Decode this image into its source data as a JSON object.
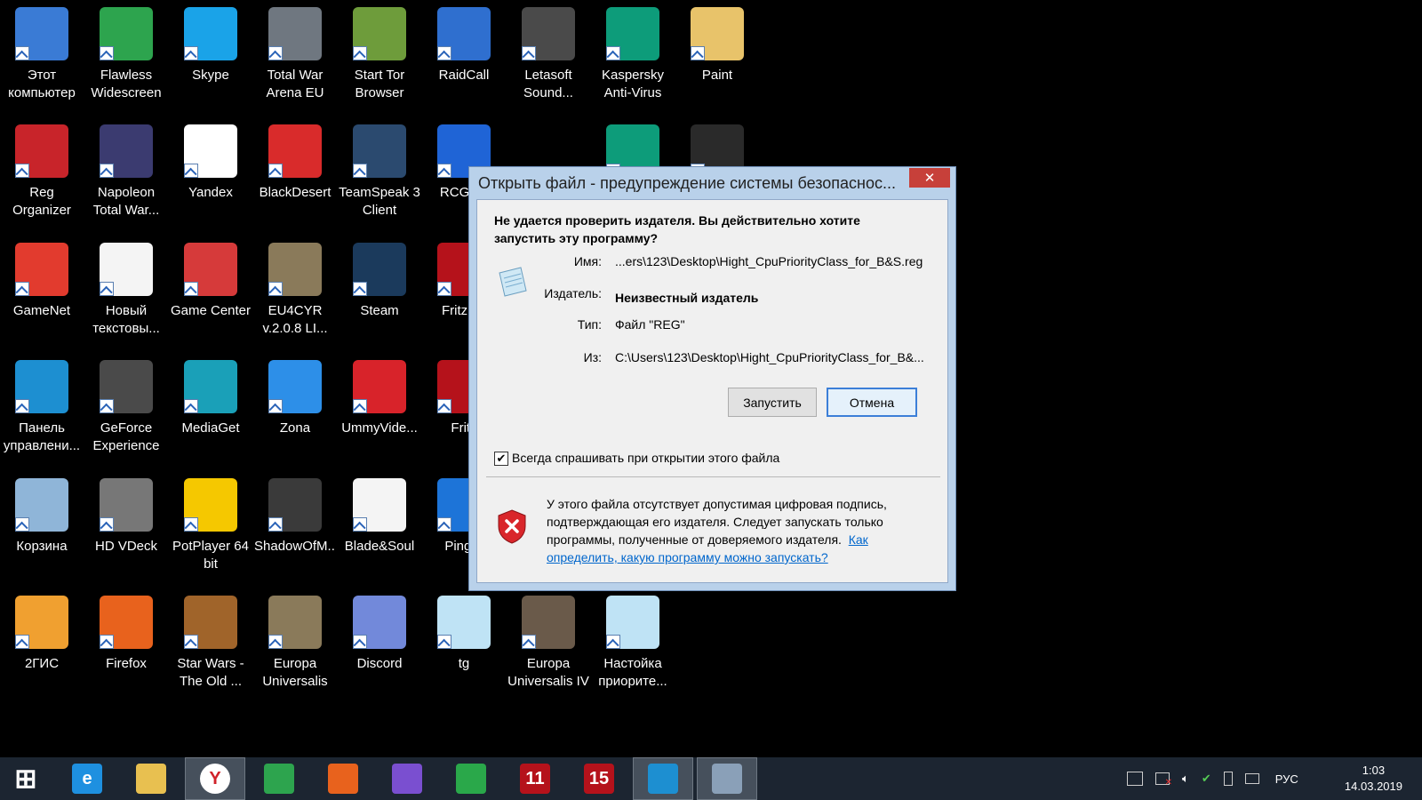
{
  "desktop": {
    "icons": [
      {
        "label": "Этот компьютер",
        "icon": "computer-icon",
        "color": "#3a7bd5"
      },
      {
        "label": "Flawless Widescreen",
        "icon": "flawless-widescreen-icon",
        "color": "#2da44e"
      },
      {
        "label": "Skype",
        "icon": "skype-icon",
        "color": "#1aa3e8"
      },
      {
        "label": "Total War Arena EU",
        "icon": "total-war-arena-icon",
        "color": "#6f7780"
      },
      {
        "label": "Start Tor Browser",
        "icon": "tor-browser-icon",
        "color": "#6e9c3b"
      },
      {
        "label": "RaidCall",
        "icon": "raidcall-icon",
        "color": "#2f6fcf"
      },
      {
        "label": "Letasoft Sound...",
        "icon": "letasoft-sound-icon",
        "color": "#4a4a4a"
      },
      {
        "label": "Kaspersky Anti-Virus",
        "icon": "kaspersky-icon",
        "color": "#0d9c7a"
      },
      {
        "label": "Paint",
        "icon": "paint-icon",
        "color": "#e8c36a"
      },
      {
        "label": "Reg Organizer",
        "icon": "reg-organizer-icon",
        "color": "#c8242a"
      },
      {
        "label": "Napoleon Total War...",
        "icon": "napoleon-icon",
        "color": "#3b3b70"
      },
      {
        "label": "Yandex",
        "icon": "yandex-icon",
        "color": "#ffffff"
      },
      {
        "label": "BlackDesert",
        "icon": "blackdesert-icon",
        "color": "#d92b2b"
      },
      {
        "label": "TeamSpeak 3 Client",
        "icon": "teamspeak-icon",
        "color": "#2b4a6f"
      },
      {
        "label": "RCGam",
        "icon": "rcgame-icon",
        "color": "#1f64d6"
      },
      {
        "label": "",
        "icon": "kaspersky-vpn-icon",
        "color": "#0d9c7a"
      },
      {
        "label": "",
        "icon": "app-icon",
        "color": "#2a2a2a"
      },
      {
        "label": "GameNet",
        "icon": "gamenet-icon",
        "color": "#e23b2e"
      },
      {
        "label": "Новый текстовы...",
        "icon": "text-file-icon",
        "color": "#f4f4f4"
      },
      {
        "label": "Game Center",
        "icon": "game-center-icon",
        "color": "#d63a3a"
      },
      {
        "label": "EU4CYR v.2.0.8 LI...",
        "icon": "eu4cyr-icon",
        "color": "#8a7a5a"
      },
      {
        "label": "Steam",
        "icon": "steam-icon",
        "color": "#1b3a5c"
      },
      {
        "label": "Fritz 15",
        "icon": "fritz15-icon",
        "color": "#b5121b"
      },
      {
        "label": "Панель управлени...",
        "icon": "control-panel-icon",
        "color": "#1d8fd1"
      },
      {
        "label": "GeForce Experience",
        "icon": "geforce-icon",
        "color": "#4a4a4a"
      },
      {
        "label": "MediaGet",
        "icon": "mediaget-icon",
        "color": "#1aa0b8"
      },
      {
        "label": "Zona",
        "icon": "zona-icon",
        "color": "#2d8fe8"
      },
      {
        "label": "UmmyVide...",
        "icon": "ummy-video-icon",
        "color": "#d8232a"
      },
      {
        "label": "Fritz",
        "icon": "fritz-icon",
        "color": "#b5121b"
      },
      {
        "label": "Корзина",
        "icon": "recycle-bin-icon",
        "color": "#8fb5d8"
      },
      {
        "label": "HD VDeck",
        "icon": "hd-vdeck-icon",
        "color": "#777777"
      },
      {
        "label": "PotPlayer 64 bit",
        "icon": "potplayer-icon",
        "color": "#f5c800"
      },
      {
        "label": "ShadowOfM...",
        "icon": "shadow-of-mordor-icon",
        "color": "#3a3a3a"
      },
      {
        "label": "Blade&Soul",
        "icon": "blade-soul-icon",
        "color": "#f4f4f4"
      },
      {
        "label": "PingPl",
        "icon": "pingplotter-icon",
        "color": "#1d74d8"
      },
      {
        "label": "2ГИС",
        "icon": "2gis-icon",
        "color": "#f0a030"
      },
      {
        "label": "Firefox",
        "icon": "firefox-icon",
        "color": "#e8621d"
      },
      {
        "label": "Star Wars - The Old ...",
        "icon": "star-wars-icon",
        "color": "#a0642a"
      },
      {
        "label": "Europa Universalis I...",
        "icon": "europa-universalis-icon",
        "color": "#8a7a5a"
      },
      {
        "label": "Discord",
        "icon": "discord-icon",
        "color": "#7289da"
      },
      {
        "label": "tg",
        "icon": "notepad-file-icon",
        "color": "#bfe3f5"
      },
      {
        "label": "Europa Universalis IV",
        "icon": "europa-universalis-iv-icon",
        "color": "#6a5a4a"
      },
      {
        "label": "Настойка приорите...",
        "icon": "notepad-file-icon",
        "color": "#bfe3f5"
      }
    ]
  },
  "dialog": {
    "title": "Открыть файл - предупреждение системы безопаснос...",
    "close_label": "✕",
    "question": "Не удается проверить издателя.  Вы действительно хотите запустить эту программу?",
    "name_label": "Имя:",
    "name_value": "...ers\\123\\Desktop\\Hight_CpuPriorityClass_for_B&S.reg",
    "publisher_label": "Издатель:",
    "publisher_value": "Неизвестный издатель",
    "type_label": "Тип:",
    "type_value": "Файл \"REG\"",
    "from_label": "Из:",
    "from_value": "C:\\Users\\123\\Desktop\\Hight_CpuPriorityClass_for_B&...",
    "run_label": "Запустить",
    "cancel_label": "Отмена",
    "checkbox_label": "Всегда спрашивать при открытии этого файла",
    "checkbox_checked": true,
    "warning_text": "У этого файла отсутствует допустимая цифровая подпись, подтверждающая его издателя.  Следует запускать только программы, полученные от доверяемого издателя.",
    "warning_link": "Как определить, какую программу можно запускать?"
  },
  "taskbar": {
    "items": [
      {
        "icon": "windows-start-icon",
        "color": "#ffffff",
        "glyph": "⊞"
      },
      {
        "icon": "internet-explorer-icon",
        "color": "#1e90e0",
        "glyph": "e"
      },
      {
        "icon": "file-explorer-icon",
        "color": "#e8c050",
        "glyph": ""
      },
      {
        "icon": "yandex-browser-icon",
        "color": "#ffffff",
        "glyph": "Y"
      },
      {
        "icon": "store-icon",
        "color": "#2da44e",
        "glyph": ""
      },
      {
        "icon": "firefox-icon",
        "color": "#e8621d",
        "glyph": ""
      },
      {
        "icon": "pen-app-icon",
        "color": "#7a4fd0",
        "glyph": ""
      },
      {
        "icon": "chrome-icon",
        "color": "#2aa84a",
        "glyph": ""
      },
      {
        "icon": "fritz11-icon",
        "color": "#b5121b",
        "glyph": "11"
      },
      {
        "icon": "fritz15-icon",
        "color": "#b5121b",
        "glyph": "15"
      },
      {
        "icon": "control-panel-icon",
        "color": "#1d8fd1",
        "glyph": ""
      },
      {
        "icon": "registry-editor-icon",
        "color": "#8aa0b8",
        "glyph": ""
      }
    ],
    "language": "РУС",
    "time": "1:03",
    "date": "14.03.2019"
  }
}
